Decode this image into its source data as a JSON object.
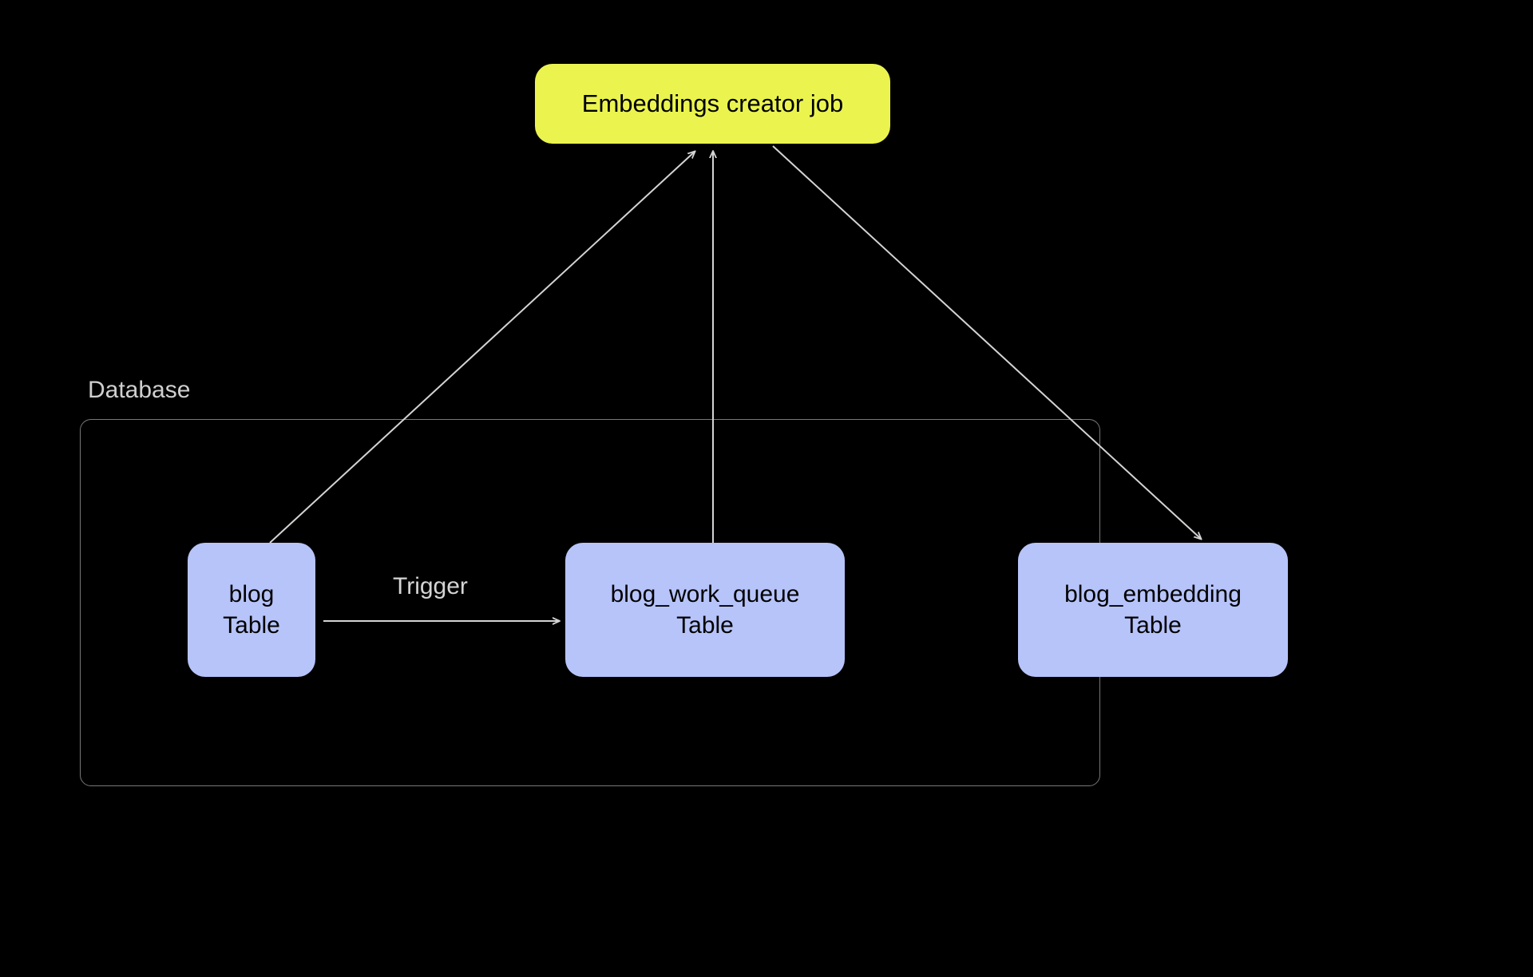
{
  "nodes": {
    "job": {
      "label": "Embeddings creator job"
    },
    "blog": {
      "line1": "blog",
      "line2": "Table"
    },
    "queue": {
      "line1": "blog_work_queue",
      "line2": "Table"
    },
    "embedding": {
      "line1": "blog_embedding",
      "line2": "Table"
    }
  },
  "container": {
    "label": "Database"
  },
  "edges": {
    "trigger": {
      "label": "Trigger"
    }
  },
  "colors": {
    "job_bg": "#EBF44F",
    "table_bg": "#B7C4FA",
    "bg": "#000000",
    "arrow": "#d4d4d4",
    "border": "#787878"
  }
}
